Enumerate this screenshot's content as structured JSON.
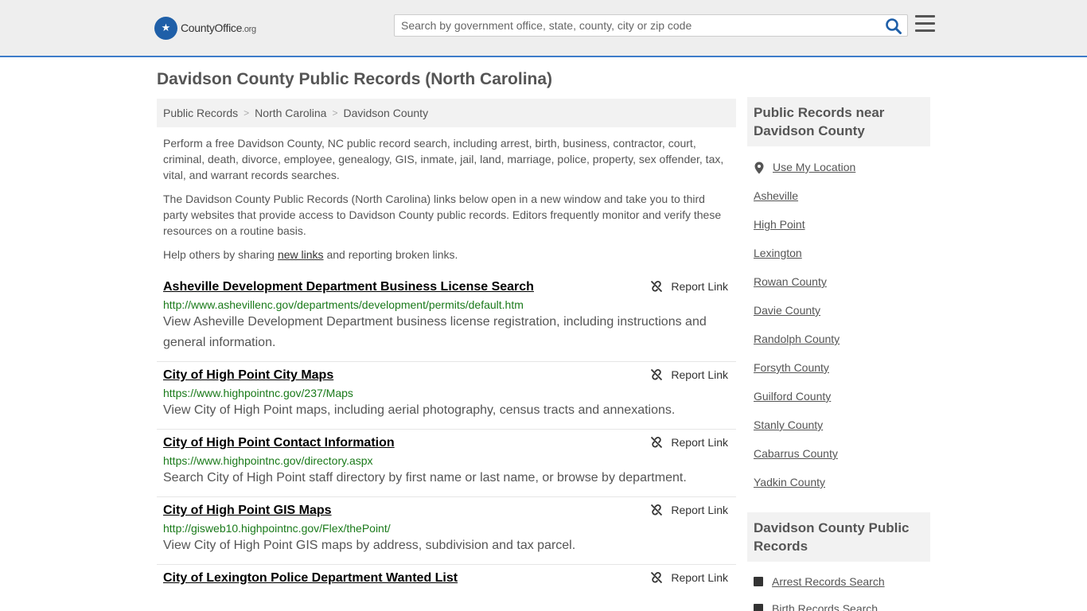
{
  "header": {
    "logo_text": "CountyOffice",
    "logo_tld": ".org",
    "search_placeholder": "Search by government office, state, county, city or zip code"
  },
  "page": {
    "title": "Davidson County Public Records (North Carolina)"
  },
  "breadcrumb": [
    "Public Records",
    "North Carolina",
    "Davidson County"
  ],
  "intro": {
    "p1": "Perform a free Davidson County, NC public record search, including arrest, birth, business, contractor, court, criminal, death, divorce, employee, genealogy, GIS, inmate, jail, land, marriage, police, property, sex offender, tax, vital, and warrant records searches.",
    "p2": "The Davidson County Public Records (North Carolina) links below open in a new window and take you to third party websites that provide access to Davidson County public records. Editors frequently monitor and verify these resources on a routine basis.",
    "p3_before": "Help others by sharing ",
    "p3_link": "new links",
    "p3_after": " and reporting broken links."
  },
  "records": [
    {
      "title": "Asheville Development Department Business License Search",
      "url": "http://www.ashevillenc.gov/departments/development/permits/default.htm",
      "desc": "View Asheville Development Department business license registration, including instructions and general information.",
      "report": "Report Link"
    },
    {
      "title": "City of High Point City Maps",
      "url": "https://www.highpointnc.gov/237/Maps",
      "desc": "View City of High Point maps, including aerial photography, census tracts and annexations.",
      "report": "Report Link"
    },
    {
      "title": "City of High Point Contact Information",
      "url": "https://www.highpointnc.gov/directory.aspx",
      "desc": "Search City of High Point staff directory by first name or last name, or browse by department.",
      "report": "Report Link"
    },
    {
      "title": "City of High Point GIS Maps",
      "url": "http://gisweb10.highpointnc.gov/Flex/thePoint/",
      "desc": "View City of High Point GIS maps by address, subdivision and tax parcel.",
      "report": "Report Link"
    },
    {
      "title": "City of Lexington Police Department Wanted List",
      "url": "",
      "desc": "",
      "report": "Report Link"
    }
  ],
  "sidebar": {
    "near_heading": "Public Records near Davidson County",
    "use_location": "Use My Location",
    "near_links": [
      "Asheville",
      "High Point",
      "Lexington",
      "Rowan County",
      "Davie County",
      "Randolph County",
      "Forsyth County",
      "Guilford County",
      "Stanly County",
      "Cabarrus County",
      "Yadkin County"
    ],
    "county_heading": "Davidson County Public Records",
    "county_links": [
      "Arrest Records Search",
      "Birth Records Search"
    ]
  },
  "colors": {
    "accent": "#3d7cc9",
    "url_green": "#1a7a1a",
    "icon_blue": "#1f5fa8"
  }
}
